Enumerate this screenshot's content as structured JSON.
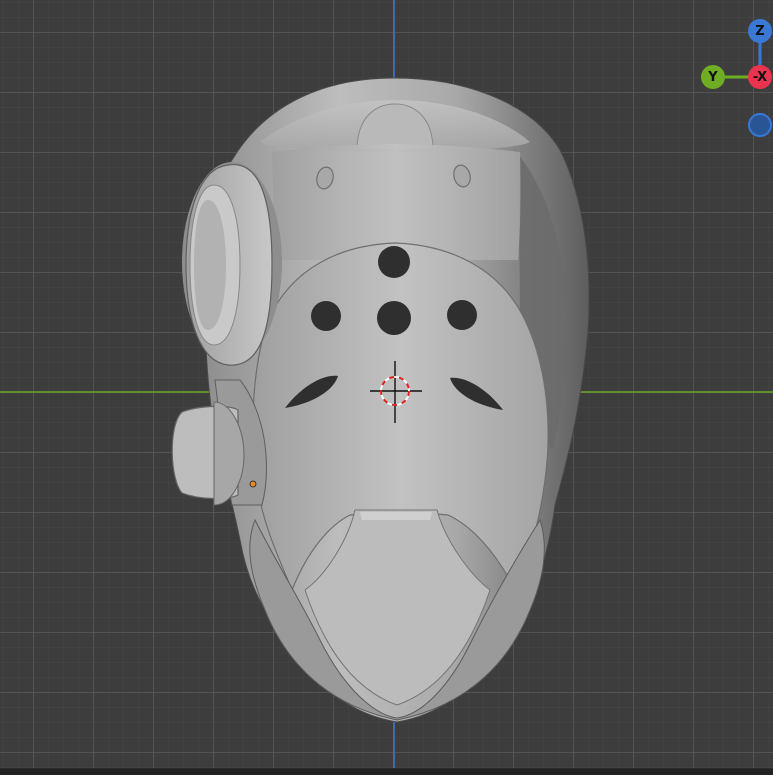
{
  "viewport": {
    "background_color": "#3d3d3d",
    "grid_color": "#565656",
    "axis_z_color": "#3f6fc9",
    "axis_y_color": "#6a9a2a"
  },
  "gizmo": {
    "z_label": "Z",
    "y_label": "Y",
    "neg_x_label": "-X",
    "z_color": "#3a78d6",
    "y_color": "#6fae24",
    "neg_x_color": "#e9344f",
    "neg_z_color": "#2a5594"
  },
  "model": {
    "icon": "helmet-mesh-icon",
    "base_color": "#b5b5b5",
    "shadow_color": "#7c7c7c"
  },
  "origin_point_color": "#e8892b"
}
